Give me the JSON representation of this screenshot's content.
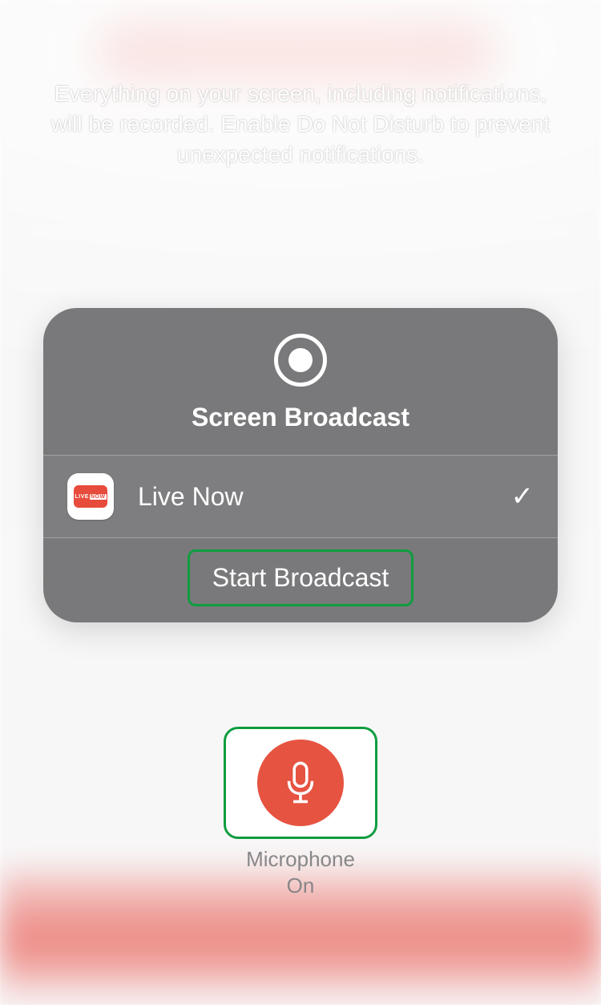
{
  "warning_text": "Everything on your screen, including notifications, will be recorded. Enable Do Not Disturb to prevent unexpected notifications.",
  "panel": {
    "title": "Screen Broadcast",
    "selected_app": {
      "name": "Live Now",
      "icon_live": "LIVE",
      "icon_now": "NOW"
    },
    "start_label": "Start Broadcast"
  },
  "microphone": {
    "label": "Microphone",
    "status": "On"
  },
  "colors": {
    "accent_red": "#e65341",
    "highlight_green": "#0f9d3f"
  }
}
